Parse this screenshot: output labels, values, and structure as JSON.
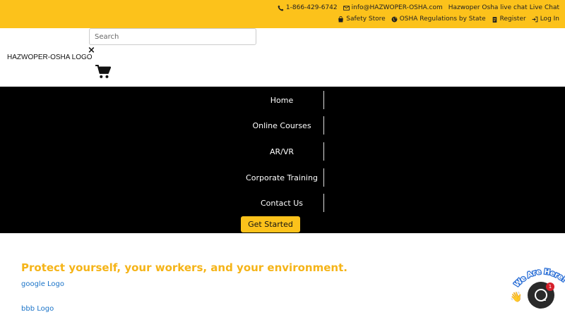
{
  "topbar": {
    "phone": "1-866-429-6742",
    "email": "info@HAZWOPER-OSHA.com",
    "live_chat_alt": "Hazwoper Osha live chat",
    "live_chat": "Live Chat",
    "safety_store": "Safety Store",
    "regulations": "OSHA Regulations by State",
    "register": "Register",
    "login": "Log In"
  },
  "header": {
    "search_placeholder": "Search",
    "close": "×",
    "logo": "HAZWOPER-OSHA LOGO"
  },
  "nav": {
    "items": [
      "Home",
      "Online Courses",
      "AR/VR",
      "Corporate Training",
      "Contact Us"
    ],
    "cta": "Get Started"
  },
  "content": {
    "headline": "Protect yourself, your workers, and your environment.",
    "google_logo": "google Logo",
    "bbb_logo": "bbb Logo"
  },
  "chat": {
    "bubble_text": "We Are Here!",
    "badge": "1"
  },
  "colors": {
    "brand_yellow": "#fcc21b",
    "headline_yellow": "#f5b418",
    "link_blue": "#1a73c8",
    "nav_black": "#000000"
  }
}
